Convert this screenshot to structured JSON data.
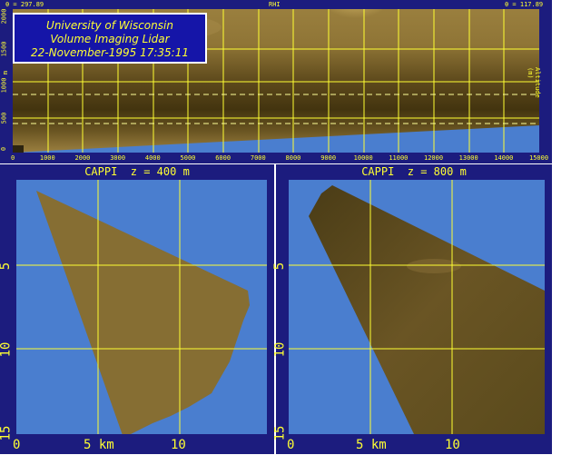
{
  "rhi": {
    "header_left": "θ = 297.89",
    "header_center": "RHI",
    "header_right": "θ = 117.89",
    "y_ticks": [
      "0",
      "500",
      "1000",
      "1500",
      "2000"
    ],
    "y_unit": "m",
    "x_ticks": [
      "0",
      "1000",
      "2000",
      "3000",
      "4000",
      "5000",
      "6000",
      "7000",
      "8000",
      "9000",
      "10000",
      "11000",
      "12000",
      "13000",
      "14000",
      "15000"
    ],
    "right_axis_label": "Altitude (m)",
    "info": {
      "line1": "University of Wisconsin",
      "line2": "Volume Imaging Lidar",
      "line3": "22-November-1995 17:35:11"
    }
  },
  "cappi_left": {
    "title": "CAPPI  z = 400 m",
    "x_ticks": [
      "0",
      "5 km",
      "10"
    ],
    "y_ticks": [
      "5",
      "10",
      "15"
    ]
  },
  "cappi_right": {
    "title": "CAPPI  z = 800 m",
    "x_ticks": [
      "0",
      "5 km",
      "10"
    ],
    "y_ticks": [
      "5",
      "10",
      "15"
    ]
  },
  "colors": {
    "frame": "#1c1c7e",
    "plot_bg": "#4a7ecf",
    "grid": "#ffff33",
    "lidar_light": "#a88a46",
    "lidar_dark": "#5c4a1e"
  }
}
